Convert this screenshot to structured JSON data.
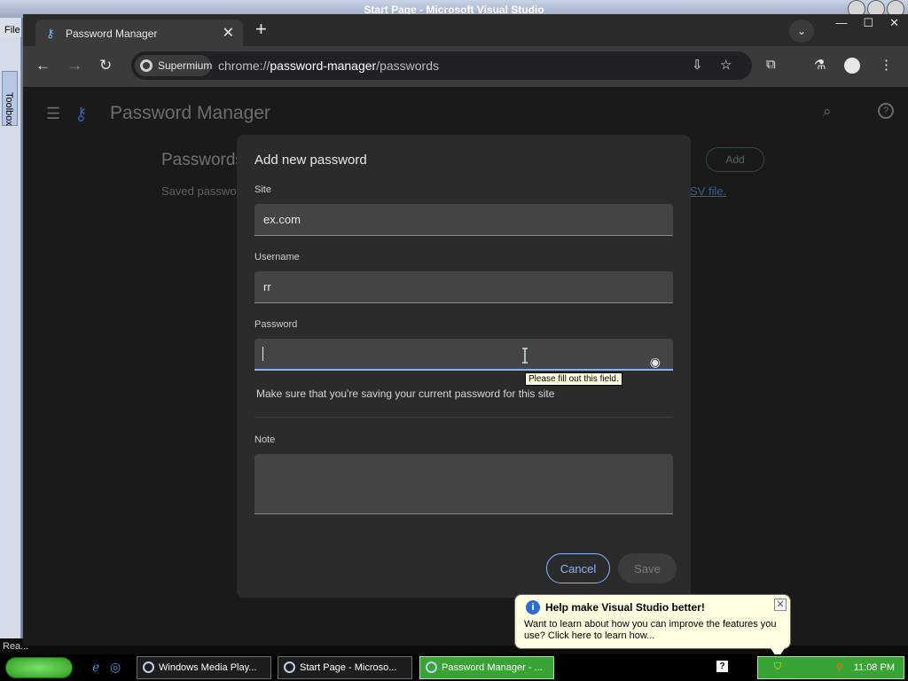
{
  "vs": {
    "title": "Start Page - Microsoft Visual Studio",
    "menu_file": "File",
    "toolbox_label": "Toolbox",
    "status_text": "Rea..."
  },
  "browser": {
    "tab_title": "Password Manager",
    "chip_label": "Supermium",
    "url_scheme": "chrome://",
    "url_host": "password-manager",
    "url_path": "/passwords"
  },
  "page": {
    "app_title": "Password Manager",
    "heading": "Passwords",
    "subtitle": "Saved passwo",
    "csv_link": "SV file.",
    "add_button": "Add"
  },
  "dialog": {
    "title": "Add new password",
    "site_label": "Site",
    "site_value": "ex.com",
    "username_label": "Username",
    "username_value": "rr",
    "password_label": "Password",
    "password_value": "",
    "tooltip": "Please fill out this field.",
    "hint": "Make sure that you're saving your current password for this site",
    "note_label": "Note",
    "note_value": "",
    "cancel_label": "Cancel",
    "save_label": "Save"
  },
  "balloon": {
    "title": "Help make Visual Studio better!",
    "text": "Want to learn about how you can improve the features you use? Click here to learn how..."
  },
  "taskbar": {
    "tasks": [
      {
        "label": "Windows Media Play..."
      },
      {
        "label": "Start Page - Microso..."
      },
      {
        "label": "Password Manager - ..."
      }
    ],
    "clock": "11:08 PM"
  },
  "colors": {
    "accent": "#8ab4f8",
    "dialog_bg": "#2b2b2b",
    "taskbar_active": "#3aa336",
    "balloon_bg": "#ffffe1"
  }
}
